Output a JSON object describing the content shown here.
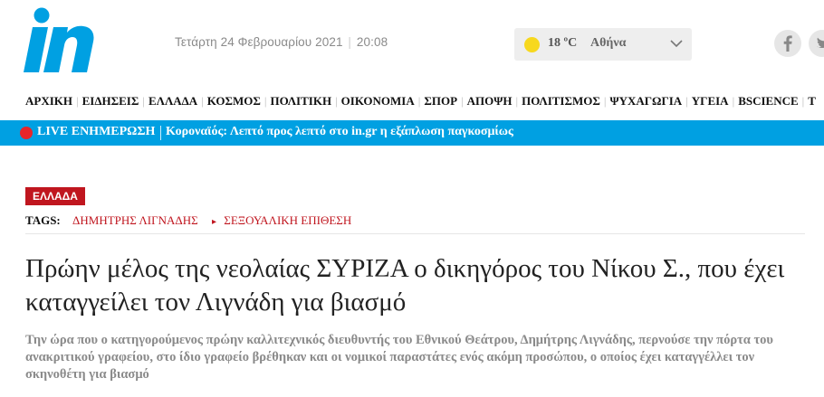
{
  "header": {
    "logo_text": "in",
    "date": "Τετάρτη 24 Φεβρουαρίου 2021",
    "time": "20:08",
    "weather": {
      "temperature": "18 ºC",
      "city": "Αθήνα"
    },
    "social": [
      "facebook-icon",
      "twitter-icon"
    ]
  },
  "nav": {
    "items": [
      "ΑΡΧΙΚΗ",
      "ΕΙΔΗΣΕΙΣ",
      "ΕΛΛΑΔΑ",
      "ΚΟΣΜΟΣ",
      "ΠΟΛΙΤΙΚΗ",
      "ΟΙΚΟΝΟΜΙΑ",
      "ΣΠΟΡ",
      "ΑΠΟΨΗ",
      "ΠΟΛΙΤΙΣΜΟΣ",
      "ΨΥΧΑΓΩΓΙΑ",
      "ΥΓΕΙΑ",
      "BSCIENCE",
      "T"
    ]
  },
  "live": {
    "label": "LIVE ΕΝΗΜΕΡΩΣΗ",
    "text": "Κοροναϊός: Λεπτό προς λεπτό στο in.gr η εξάπλωση παγκοσμίως"
  },
  "article": {
    "category": "ΕΛΛΑΔΑ",
    "tags_label": "TAGS:",
    "tags": [
      "ΔΗΜΗΤΡΗΣ ΛΙΓΝΑΔΗΣ",
      "ΣΕΞΟΥΑΛΙΚΗ ΕΠΙΘΕΣΗ"
    ],
    "headline": "Πρώην μέλος της νεολαίας ΣΥΡΙΖΑ ο δικηγόρος του Νίκου Σ., που έχει καταγγείλει τον Λιγνάδη για βιασμό",
    "lede": "Την ώρα που ο κατηγορούμενος πρώην καλλιτεχνικός διευθυντής του Εθνικού Θεάτρου, Δημήτρης Λιγνάδης, περνούσε την πόρτα του ανακριτικού γραφείου, στο ίδιο γραφείο βρέθηκαν και οι νομικοί παραστάτες ενός ακόμη προσώπου, ο οποίος έχει καταγγέλλει τον σκηνοθέτη για βιασμό"
  },
  "colors": {
    "brand_blue": "#00a0e2",
    "accent_red": "#c0161f",
    "live_dot": "#e8252a",
    "sun": "#f7d81e"
  }
}
